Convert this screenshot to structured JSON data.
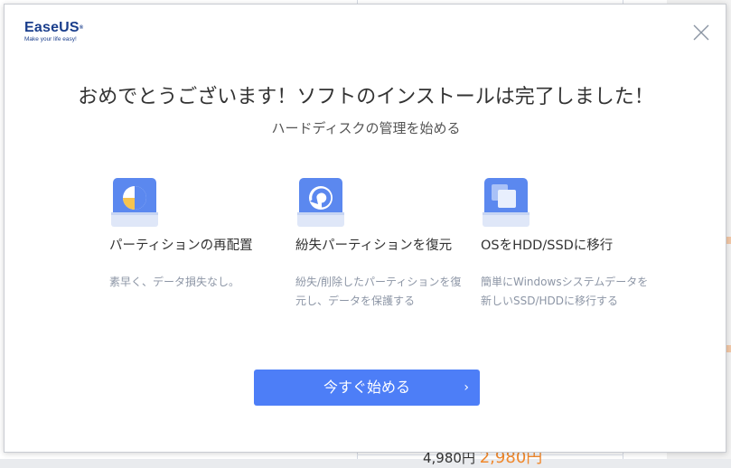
{
  "background": {
    "fragment_price_old": "4,980円",
    "fragment_price_new": "2,980円"
  },
  "dialog": {
    "logo": {
      "brand": "EaseUS",
      "reg_mark": "®",
      "tagline": "Make your life easy!"
    },
    "close_icon": "close-icon",
    "title": "おめでとうございます！ソフトのインストールは完了しました！",
    "subtitle": "ハードディスクの管理を始める",
    "features": [
      {
        "icon": "partition-pie-icon",
        "name": "パーティションの再配置",
        "desc": "素早く、データ損失なし。"
      },
      {
        "icon": "partition-recovery-icon",
        "name": "紛失パーティションを復元",
        "desc": "紛失/削除したパーティションを復元し、データを保護する"
      },
      {
        "icon": "os-migrate-icon",
        "name": "OSをHDD/SSDに移行",
        "desc": "簡単にWindowsシステムデータを新しいSSD/HDDに移行する"
      }
    ],
    "cta": {
      "label": "今すぐ始める",
      "chevron": "›"
    }
  },
  "colors": {
    "accent": "#4d7ef7",
    "brand": "#1a3e8c",
    "icon_blue": "#5b88ef",
    "icon_light": "#dfe7f8",
    "pie_yellow": "#f6c44f"
  }
}
